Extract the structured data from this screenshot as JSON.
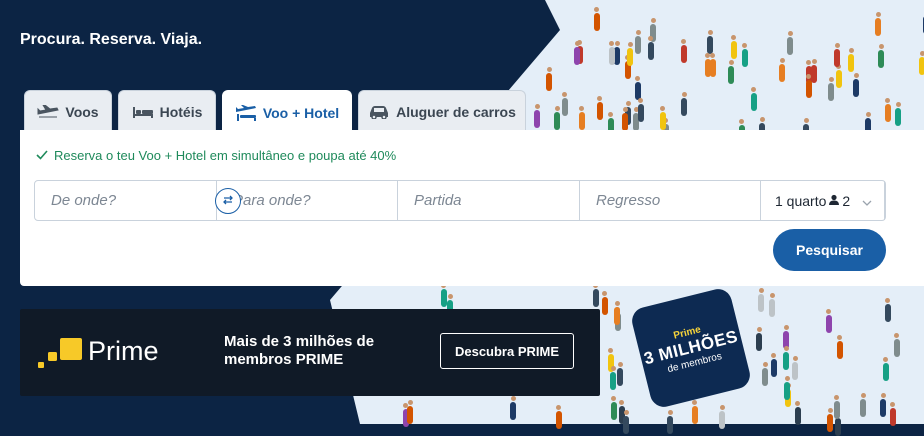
{
  "slogan": "Procura. Reserva. Viaja.",
  "tabs": [
    {
      "label": "Voos",
      "icon": "plane-icon"
    },
    {
      "label": "Hotéis",
      "icon": "bed-icon"
    },
    {
      "label": "Voo + Hotel",
      "icon": "plane-hotel-icon",
      "active": true
    },
    {
      "label": "Aluguer de carros",
      "icon": "car-icon"
    }
  ],
  "promo": "Reserva o teu Voo + Hotel em simultâneo e poupa até 40%",
  "fields": {
    "from_placeholder": "De onde?",
    "to_placeholder": "Para onde?",
    "departure_placeholder": "Partida",
    "return_placeholder": "Regresso",
    "rooms": "1 quarto",
    "guests": "2"
  },
  "search_button": "Pesquisar",
  "prime": {
    "brand": "Prime",
    "text": "Mais de 3 milhões de membros PRIME",
    "button": "Descubra PRIME",
    "badge_top": "Prime",
    "badge_main": "3 MILHÕES",
    "badge_sub": "de membros"
  },
  "colors": {
    "dark_bg": "#0c2444",
    "accent": "#1a5fa6",
    "success": "#1f8a5b",
    "prime_yellow": "#f7c928"
  }
}
